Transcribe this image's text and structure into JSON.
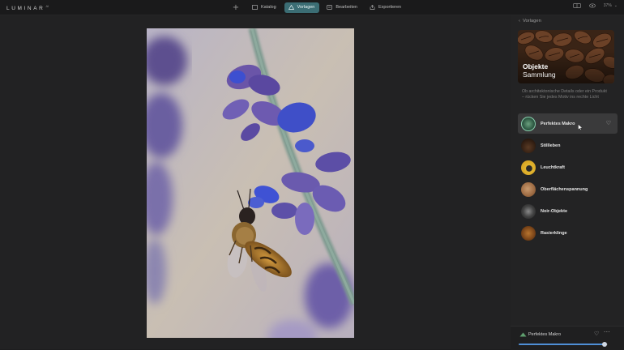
{
  "app": {
    "logo": "LUMINAR",
    "logo_sup": "AI"
  },
  "nav": {
    "add_icon": "plus-icon",
    "tabs": [
      {
        "label": "Katalog",
        "icon": "catalog-icon",
        "active": false
      },
      {
        "label": "Vorlagen",
        "icon": "templates-icon",
        "active": true
      },
      {
        "label": "Bearbeiten",
        "icon": "edit-icon",
        "active": false
      },
      {
        "label": "Exportieren",
        "icon": "export-icon",
        "active": false
      }
    ]
  },
  "toolbar": {
    "zoom": "37%"
  },
  "panel": {
    "back_label": "Vorlagen",
    "collection": {
      "title": "Objekte",
      "subtitle": "Sammlung"
    },
    "description": "Ob architektonische Details oder ein Produkt – rücken Sie jedes Motiv ins rechte Licht",
    "items": [
      {
        "label": "Perfektes Makro"
      },
      {
        "label": "Stillleben"
      },
      {
        "label": "Leuchtkraft"
      },
      {
        "label": "Oberflächenspannung"
      },
      {
        "label": "Noir-Objekte"
      },
      {
        "label": "Rasierklinge"
      }
    ]
  },
  "bottom": {
    "label": "Perfektes Makro",
    "amount": 0.96
  },
  "colors": {
    "accent": "#3b6d74",
    "slider": "#4f8fd6"
  }
}
